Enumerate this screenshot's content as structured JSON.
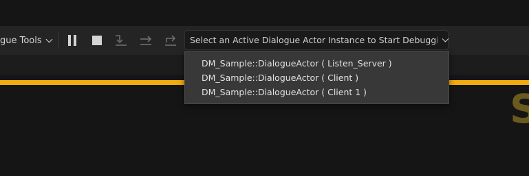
{
  "toolbar": {
    "tools_menu_label": "gue Tools",
    "buttons": [
      {
        "name": "pause",
        "icon": "pause-icon"
      },
      {
        "name": "stop",
        "icon": "stop-icon"
      },
      {
        "name": "step-into",
        "icon": "step-into-icon"
      },
      {
        "name": "step-over",
        "icon": "step-over-icon"
      },
      {
        "name": "step-out",
        "icon": "step-out-icon"
      }
    ],
    "debug_select_placeholder": "Select an Active Dialogue Actor Instance to Start Debugging..."
  },
  "dropdown": {
    "items": [
      "DM_Sample::DialogueActor ( Listen_Server )",
      "DM_Sample::DialogueActor ( Client )",
      "DM_Sample::DialogueActor ( Client 1 )"
    ]
  },
  "canvas": {
    "partial_title_letter": "S"
  },
  "colors": {
    "accent": "#f0ab0d",
    "background": "#151515",
    "toolbar": "#242424",
    "popup": "#383838"
  }
}
